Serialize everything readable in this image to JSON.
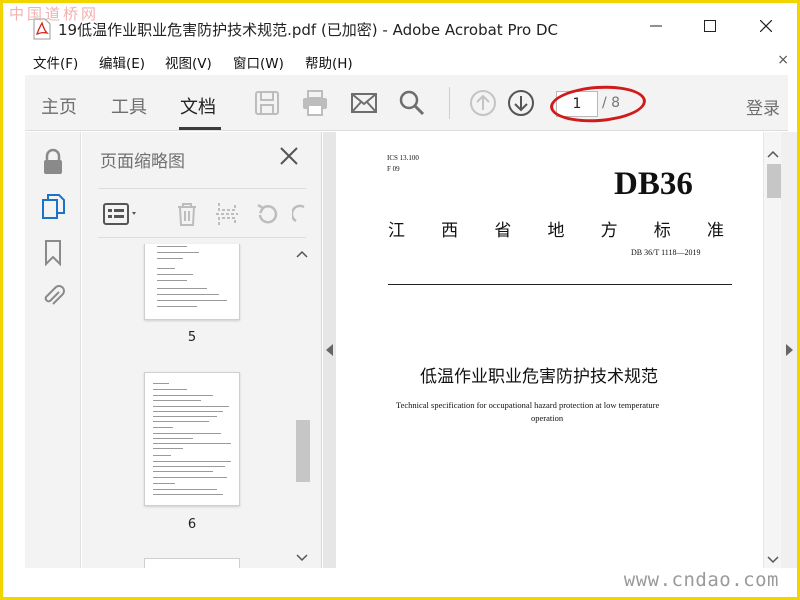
{
  "watermark": {
    "top": "中国道桥网",
    "bottom": "www.cndao.com"
  },
  "window": {
    "title": "19低温作业职业危害防护技术规范.pdf (已加密) - Adobe Acrobat Pro DC"
  },
  "menu": {
    "items": [
      "文件(F)",
      "编辑(E)",
      "视图(V)",
      "窗口(W)",
      "帮助(H)"
    ],
    "close": "×"
  },
  "toolbar": {
    "tabs": [
      "主页",
      "工具",
      "文档"
    ],
    "active_tab": "文档",
    "current_page": "1",
    "total_pages": "/ 8",
    "login": "登录"
  },
  "thumbnails": {
    "title": "页面缩略图",
    "pages": [
      "5",
      "6"
    ]
  },
  "document": {
    "ics": "ICS 13.100",
    "ccs": "F 09",
    "code": "DB36",
    "province": [
      "江",
      "西",
      "省",
      "地",
      "方",
      "标",
      "准"
    ],
    "std_number": "DB 36/T 1118—2019",
    "title_cn": "低温作业职业危害防护技术规范",
    "title_en_1": "Technical specification for occupational hazard protection at low temperature",
    "title_en_2": "operation"
  },
  "colors": {
    "accent_red": "#d11a1a",
    "pdf_red": "#d9241c",
    "toolbar_bg": "#f3f3f3"
  }
}
